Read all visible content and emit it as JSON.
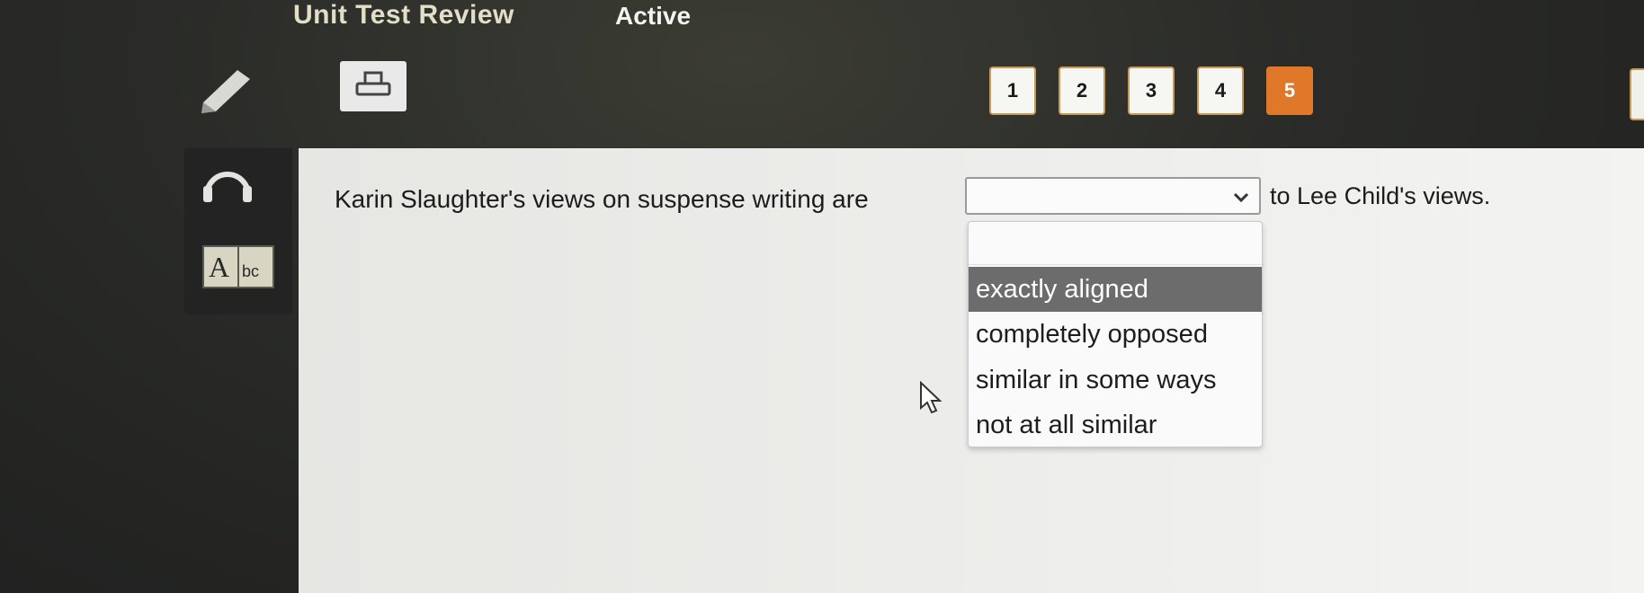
{
  "titlebar": {
    "title": "Unit Test Review",
    "status": "Active"
  },
  "toolbar": {
    "tools": [
      {
        "icon": "pencil-icon"
      },
      {
        "icon": "print-icon"
      }
    ],
    "question_nav": [
      "1",
      "2",
      "3",
      "4",
      "5"
    ],
    "active_question": "5"
  },
  "sidebar": {
    "tools": [
      {
        "icon": "headphones-icon"
      },
      {
        "icon": "dictionary-icon",
        "label": "Abc"
      }
    ]
  },
  "question": {
    "text_before": "Karin Slaughter's views on suspense writing are",
    "text_after": "to Lee Child's views.",
    "selected_value": "",
    "options": [
      "",
      "exactly aligned",
      "completely opposed",
      "similar in some ways",
      "not at all similar"
    ],
    "highlighted_option": "exactly aligned"
  },
  "colors": {
    "active_question_bg": "#e0782a",
    "question_border": "#c89a58",
    "highlight_bg": "#6c6c6c",
    "content_bg": "#ececea"
  }
}
